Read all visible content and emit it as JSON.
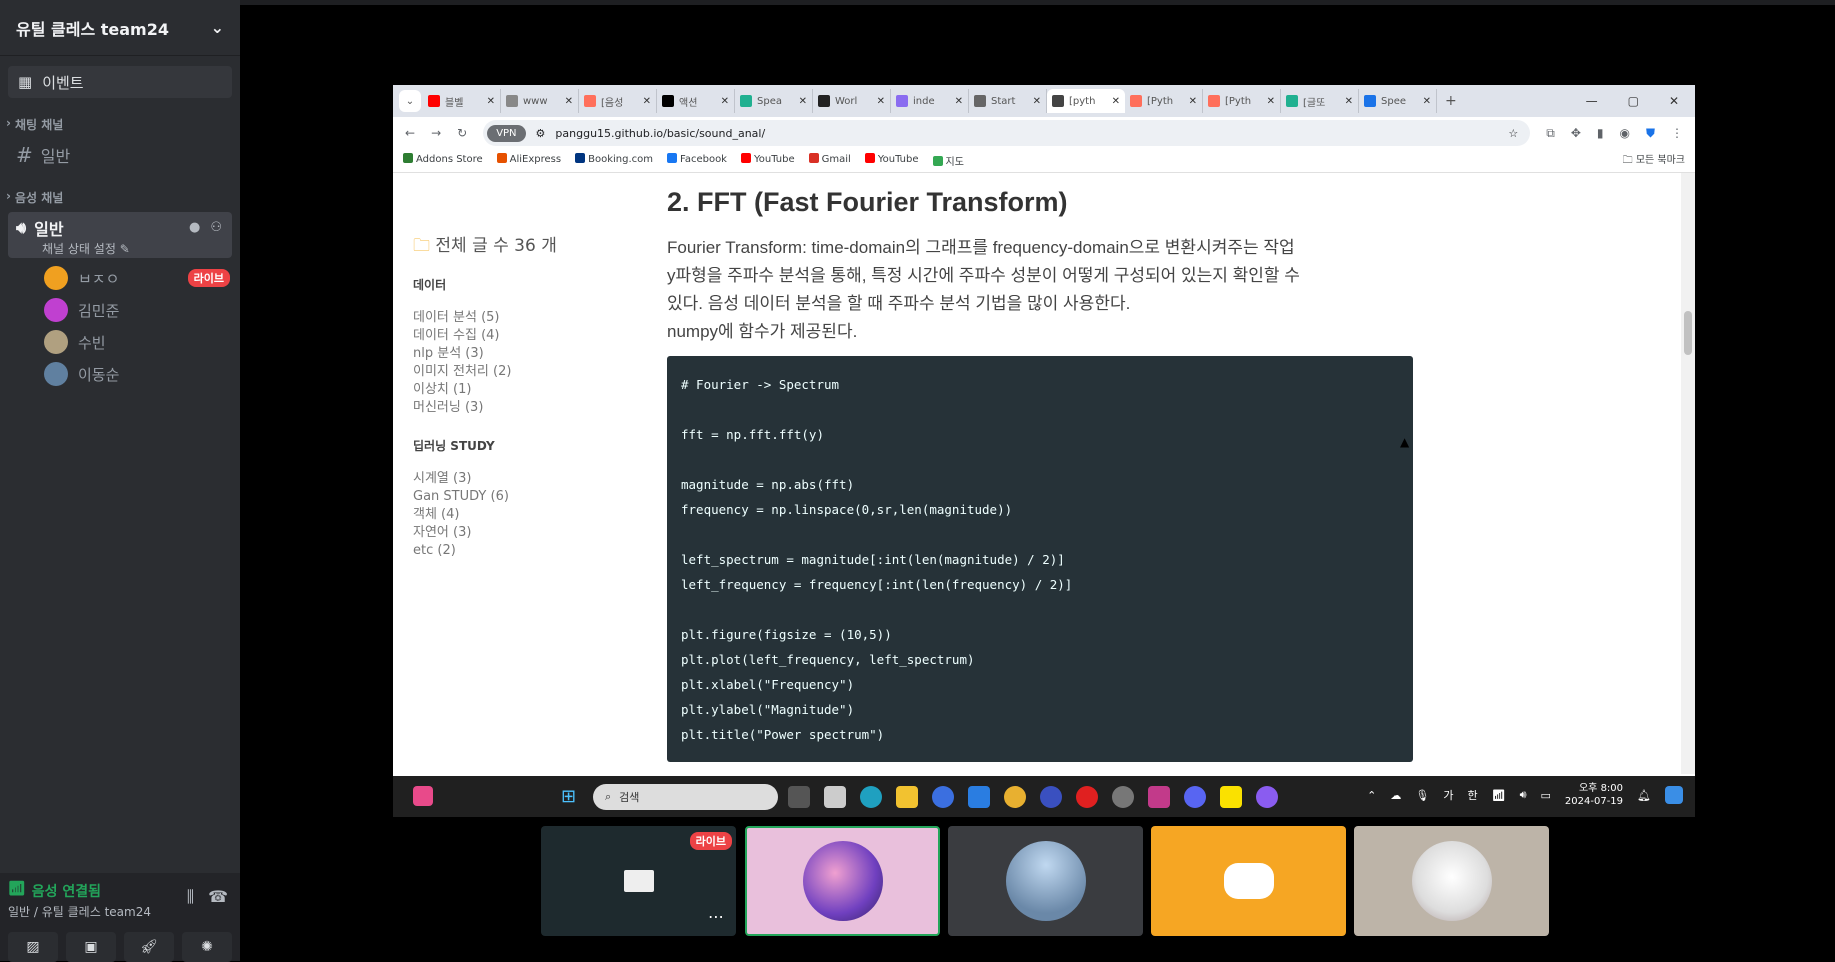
{
  "discord": {
    "server_name": "유틸 클레스 team24",
    "event_label": "이벤트",
    "text_category": "채팅 채널",
    "text_channel": "일반",
    "voice_category": "음성 채널",
    "voice_channel": "일반",
    "voice_status": "채널 상태 설정",
    "users": [
      {
        "name": "ㅂㅈㅇ",
        "live": "라이브",
        "color": "#f0a020"
      },
      {
        "name": "김민준",
        "color": "#c040d0"
      },
      {
        "name": "수빈",
        "color": "#b0a080"
      },
      {
        "name": "이동순",
        "color": "#6080a0"
      }
    ],
    "voice_connected": "음성 연결됨",
    "voice_connected_sub": "일반 / 유틸 클레스 team24"
  },
  "browser": {
    "tabs": [
      {
        "label": "블벨",
        "color": "#ff0000"
      },
      {
        "label": "www",
        "color": "#888"
      },
      {
        "label": "[음성",
        "color": "#ff6f5b"
      },
      {
        "label": "액션",
        "color": "#000"
      },
      {
        "label": "Spea",
        "color": "#20b090"
      },
      {
        "label": "Worl",
        "color": "#222"
      },
      {
        "label": "inde",
        "color": "#8a6cf0"
      },
      {
        "label": "Start",
        "color": "#666"
      },
      {
        "label": "[pyth",
        "color": "#444",
        "active": true
      },
      {
        "label": "[Pyth",
        "color": "#ff6f5b"
      },
      {
        "label": "[Pyth",
        "color": "#ff6f5b"
      },
      {
        "label": "[글또",
        "color": "#20b090"
      },
      {
        "label": "Spee",
        "color": "#1a73e8"
      }
    ],
    "vpn": "VPN",
    "url": "panggu15.github.io/basic/sound_anal/",
    "bookmarks": [
      {
        "label": "Addons Store",
        "color": "#2e7d32"
      },
      {
        "label": "AliExpress",
        "color": "#e65100"
      },
      {
        "label": "Booking.com",
        "color": "#003580"
      },
      {
        "label": "Facebook",
        "color": "#1877f2"
      },
      {
        "label": "YouTube",
        "color": "#ff0000"
      },
      {
        "label": "Gmail",
        "color": "#d93025"
      },
      {
        "label": "YouTube",
        "color": "#ff0000"
      },
      {
        "label": "지도",
        "color": "#34a853"
      }
    ],
    "all_bookmarks": "모든 북마크"
  },
  "blog": {
    "total_posts": "전체 글 수 36 개",
    "cat1": "데이터",
    "cat1_items": [
      "데이터 분석 (5)",
      "데이터 수집 (4)",
      "nlp 분석 (3)",
      "이미지 전처리 (2)",
      "이상치 (1)",
      "머신러닝 (3)"
    ],
    "cat2": "딥러닝 STUDY",
    "cat2_items": [
      "시계열 (3)",
      "Gan STUDY (6)",
      "객체 (4)",
      "자연어 (3)",
      "etc (2)"
    ],
    "heading": "2. FFT (Fast Fourier Transform)",
    "para1": "Fourier Transform: time-domain의 그래프를 frequency-domain으로 변환시켜주는 작업",
    "para2": "y파형을 주파수 분석을 통해, 특정 시간에 주파수 성분이 어떻게 구성되어 있는지 확인할 수",
    "para3": "있다. 음성 데이터 분석을 할 때 주파수 분석 기법을 많이 사용한다.",
    "para4": "numpy에 함수가 제공된다.",
    "code": [
      "# Fourier -> Spectrum",
      "",
      "fft = np.fft.fft(y)",
      "",
      "magnitude = np.abs(fft)",
      "frequency = np.linspace(0,sr,len(magnitude))",
      "",
      "left_spectrum = magnitude[:int(len(magnitude) / 2)]",
      "left_frequency = frequency[:int(len(frequency) / 2)]",
      "",
      "plt.figure(figsize = (10,5))",
      "plt.plot(left_frequency, left_spectrum)",
      "plt.xlabel(\"Frequency\")",
      "plt.ylabel(\"Magnitude\")",
      "plt.title(\"Power spectrum\")"
    ]
  },
  "taskbar": {
    "search": "검색",
    "ime1": "가",
    "ime2": "한",
    "time": "오후 8:00",
    "date": "2024-07-19"
  },
  "tiles": {
    "live": "라이브"
  }
}
